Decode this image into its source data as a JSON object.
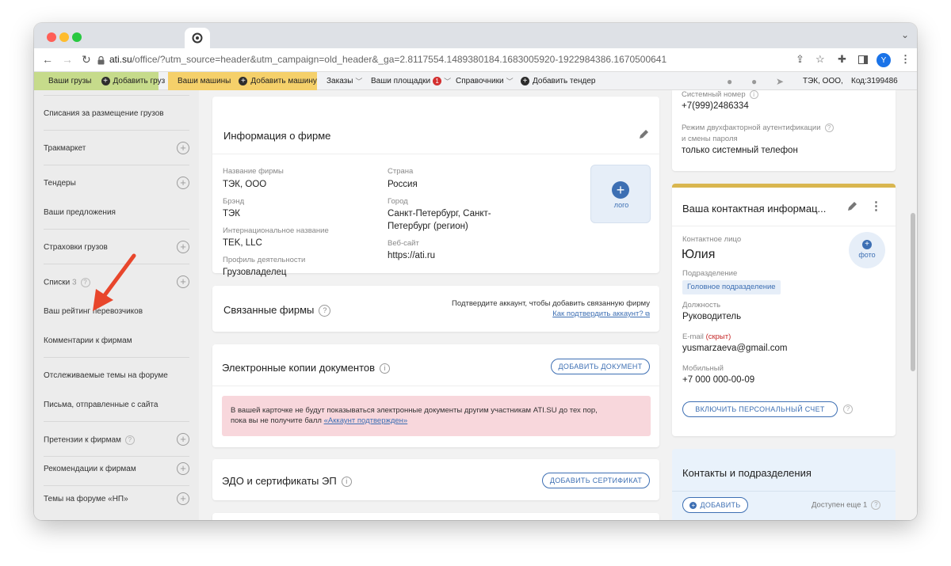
{
  "browser": {
    "url_host": "ati.su",
    "url_rest": "/office/?utm_source=header&utm_campaign=old_header&_ga=2.8117554.1489380184.1683005920-1922984386.1670500641",
    "avatar_letter": "Y"
  },
  "menu": {
    "cargo": "Ваши грузы",
    "add_cargo": "Добавить груз",
    "trucks": "Ваши машины",
    "add_truck": "Добавить машину",
    "orders": "Заказы",
    "platforms": "Ваши площадки",
    "platforms_badge": "1",
    "references": "Справочники",
    "add_tender": "Добавить тендер",
    "company": "ТЭК, ООО,",
    "code": "Код:3199486"
  },
  "sidebar": {
    "items": [
      "Списания за размещение грузов",
      "Тракмаркет",
      "Тендеры",
      "Ваши предложения",
      "Страховки грузов",
      "Списки",
      "Ваш рейтинг перевозчиков",
      "Комментарии к фирмам",
      "Отслеживаемые темы на форуме",
      "Письма, отправленные с сайта",
      "Претензии к фирмам",
      "Рекомендации к фирмам",
      "Темы на форуме «НП»"
    ],
    "lists_count": "3"
  },
  "firm_info": {
    "title": "Информация о фирме",
    "name_label": "Название фирмы",
    "name": "ТЭК, ООО",
    "brand_label": "Брэнд",
    "brand": "ТЭК",
    "intl_label": "Интернациональное название",
    "intl": "TEK, LLC",
    "profile_label": "Профиль деятельности",
    "profile": "Грузовладелец",
    "country_label": "Страна",
    "country": "Россия",
    "city_label": "Город",
    "city_line1": "Санкт-Петербург, Санкт-",
    "city_line2": "Петербург (регион)",
    "website_label": "Веб-сайт",
    "website": "https://ati.ru",
    "logo_label": "лого"
  },
  "linked": {
    "title": "Связанные фирмы",
    "note": "Подтвердите аккаунт, чтобы добавить связанную фирму",
    "link": "Как подтвердить аккаунт?"
  },
  "docs": {
    "title": "Электронные копии документов",
    "button": "ДОБАВИТЬ ДОКУМЕНТ",
    "alert_line1": "В вашей карточке не будут показываться электронные документы другим участникам ATI.SU до тех пор,",
    "alert_line2": "пока вы не получите балл",
    "alert_link": "«Аккаунт подтвержден»"
  },
  "edo": {
    "title": "ЭДО и сертификаты ЭП",
    "button": "ДОБАВИТЬ СЕРТИФИКАТ"
  },
  "security": {
    "system_number_label": "Системный номер",
    "system_number": "+7(999)2486334",
    "twofa_label_line1": "Режим двухфакторной аутентификации",
    "twofa_label_line2": "и смены пароля",
    "twofa_value": "только системный телефон"
  },
  "contact": {
    "title": "Ваша контактная информац...",
    "person_label": "Контактное лицо",
    "person": "Юлия",
    "photo_label": "фото",
    "dept_label": "Подразделение",
    "dept": "Головное подразделение",
    "position_label": "Должность",
    "position": "Руководитель",
    "email_label": "E-mail",
    "email_hidden": "(скрыт)",
    "email": "yusmarzaeva@gmail.com",
    "mobile_label": "Мобильный",
    "mobile": "+7 000 000-00-09",
    "account_button": "ВКЛЮЧИТЬ ПЕРСОНАЛЬНЫЙ СЧЕТ"
  },
  "contacts_units": {
    "title": "Контакты и подразделения",
    "add_button": "ДОБАВИТЬ",
    "available": "Доступен еще 1"
  },
  "colors": {
    "cargo_bg": "#c6db8b",
    "trucks_bg": "#f5d06a",
    "accent_blue": "#3d6fb3",
    "alert_bg": "#f8d7dc",
    "arrow": "#e8462c"
  }
}
